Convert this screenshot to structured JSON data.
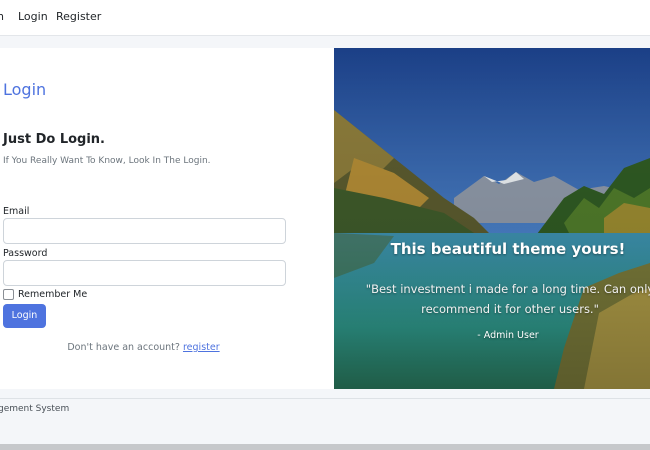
{
  "navbar": {
    "brand_fragment": "n",
    "links": {
      "login": "Login",
      "register": "Register"
    }
  },
  "login_card": {
    "title": "Login",
    "headline": "Just Do Login.",
    "subline": "If You Really Want To Know, Look In The Login.",
    "email_label": "Email",
    "email_value": "",
    "password_label": "Password",
    "password_value": "",
    "remember_label": "Remember Me",
    "remember_checked": false,
    "submit_label": "Login",
    "signup_prompt": "Don't have an account?",
    "signup_link": "register"
  },
  "hero": {
    "title": "This beautiful theme yours!",
    "quote": "\"Best investment i made for a long time. Can only recommend it for other users.\"",
    "author": "- Admin User"
  },
  "footer": {
    "text": "gement System"
  },
  "colors": {
    "accent": "#4e73df",
    "page_bg": "#f4f6f9"
  }
}
